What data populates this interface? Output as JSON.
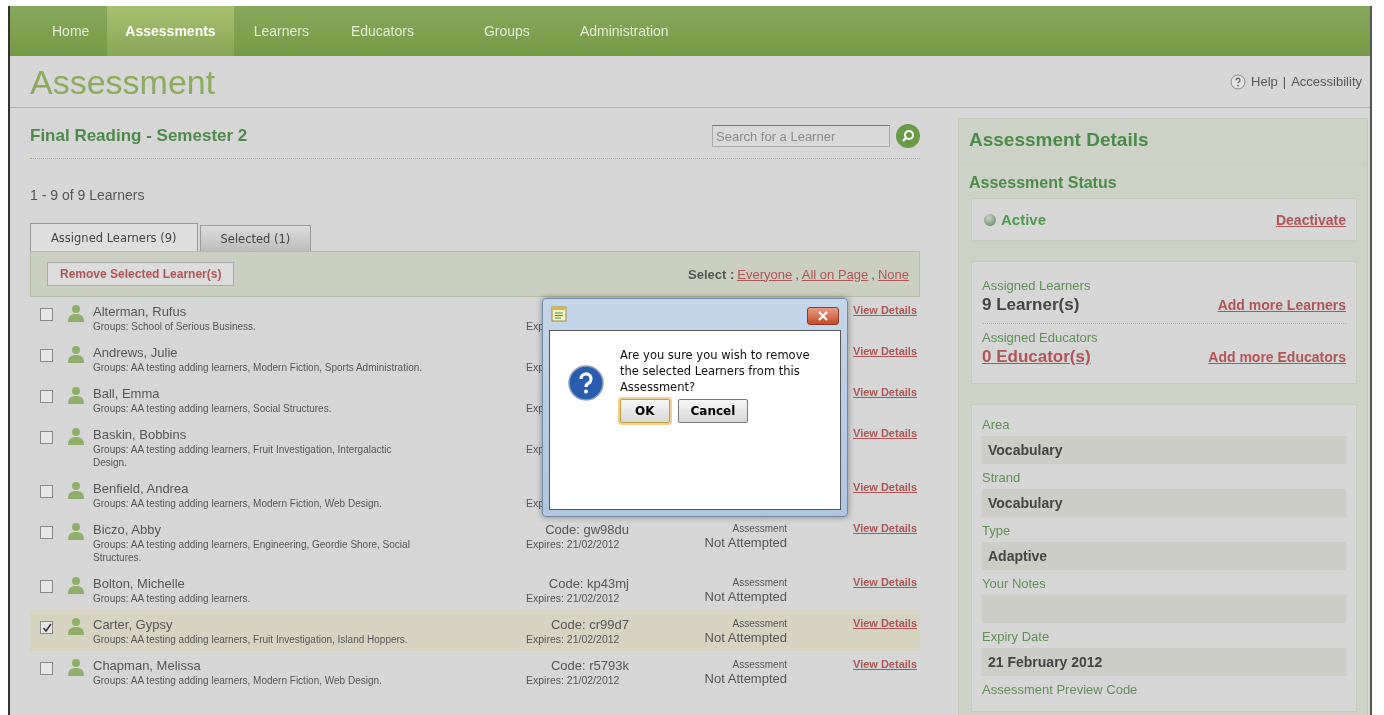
{
  "nav": [
    {
      "label": "Home",
      "selected": false
    },
    {
      "label": "Assessments",
      "selected": true
    },
    {
      "label": "Learners",
      "selected": false
    },
    {
      "label": "Educators",
      "selected": false
    },
    {
      "label": "Groups",
      "selected": false
    },
    {
      "label": "Administration",
      "selected": false
    }
  ],
  "page_title": "Assessment",
  "header_links": {
    "help": "Help",
    "separator": "|",
    "accessibility": "Accessibility"
  },
  "assessment_name": "Final Reading - Semester 2",
  "search": {
    "placeholder": "Search for a Learner"
  },
  "count": "1 - 9 of 9 Learners",
  "tabs": [
    {
      "label": "Assigned Learners (9)",
      "selected": true
    },
    {
      "label": "Selected (1)",
      "selected": false
    }
  ],
  "remove_button": "Remove Selected Learner(s)",
  "select": {
    "label": "Select :",
    "options": [
      "Everyone",
      "All on Page",
      "None"
    ],
    "separator": ","
  },
  "learners": [
    {
      "name": "Alterman, Rufus",
      "groups": "Groups: School of Serious Business.",
      "checked": false,
      "expires": "Exp",
      "view": "View Details"
    },
    {
      "name": "Andrews, Julie",
      "groups": "Groups: AA testing adding learners, Modern Fiction, Sports Administration.",
      "checked": false,
      "expires": "Exp",
      "view": "View Details"
    },
    {
      "name": "Ball, Emma",
      "groups": "Groups: AA testing adding learners, Social Structures.",
      "checked": false,
      "expires": "Exp",
      "view": "View Details"
    },
    {
      "name": "Baskin, Bobbins",
      "groups": "Groups: AA testing adding learners, Fruit Investigation, Intergalactic Design.",
      "checked": false,
      "expires": "Exp",
      "view": "View Details"
    },
    {
      "name": "Benfield, Andrea",
      "groups": "Groups: AA testing adding learners, Modern Fiction, Web Design.",
      "checked": false,
      "expires": "Exp",
      "view": "View Details"
    },
    {
      "name": "Biczo, Abby",
      "groups": "Groups: AA testing adding learners, Engineering, Geordie Shore, Social Structures.",
      "checked": false,
      "code": "Code: gw98du",
      "expires": "Expires: 21/02/2012",
      "status_type": "Assessment",
      "status": "Not Attempted",
      "view": "View Details"
    },
    {
      "name": "Bolton, Michelle",
      "groups": "Groups: AA testing adding learners.",
      "checked": false,
      "code": "Code: kp43mj",
      "expires": "Expires: 21/02/2012",
      "status_type": "Assessment",
      "status": "Not Attempted",
      "view": "View Details"
    },
    {
      "name": "Carter, Gypsy",
      "groups": "Groups: AA testing adding learners, Fruit Investigation, Island Hoppers.",
      "checked": true,
      "code": "Code: cr99d7",
      "expires": "Expires: 21/02/2012",
      "status_type": "Assessment",
      "status": "Not Attempted",
      "view": "View Details"
    },
    {
      "name": "Chapman, Melissa",
      "groups": "Groups: AA testing adding learners, Modern Fiction, Web Design.",
      "checked": false,
      "code": "Code: r5793k",
      "expires": "Expires: 21/02/2012",
      "status_type": "Assessment",
      "status": "Not Attempted",
      "view": "View Details"
    }
  ],
  "dialog": {
    "message": "Are you sure you wish to remove the selected Learners from this Assessment?",
    "buttons": [
      {
        "label": "OK",
        "selected": true
      },
      {
        "label": "Cancel",
        "selected": false
      }
    ]
  },
  "details": {
    "title": "Assessment Details",
    "status_heading": "Assessment Status",
    "status": "Active",
    "status_action": "Deactivate",
    "assigned": [
      {
        "label": "Assigned Learners",
        "value": "9 Learner(s)",
        "kind": "text",
        "action": "Add more Learners"
      },
      {
        "label": "Assigned Educators",
        "value": "0 Educator(s)",
        "kind": "link",
        "action": "Add more Educators"
      }
    ],
    "fields": [
      {
        "label": "Area",
        "value": "Vocabulary"
      },
      {
        "label": "Strand",
        "value": "Vocabulary"
      },
      {
        "label": "Type",
        "value": "Adaptive"
      },
      {
        "label": "Your Notes"
      },
      {
        "label": "Expiry Date",
        "value": "21 February 2012"
      },
      {
        "label": "Assessment Preview Code"
      }
    ]
  }
}
